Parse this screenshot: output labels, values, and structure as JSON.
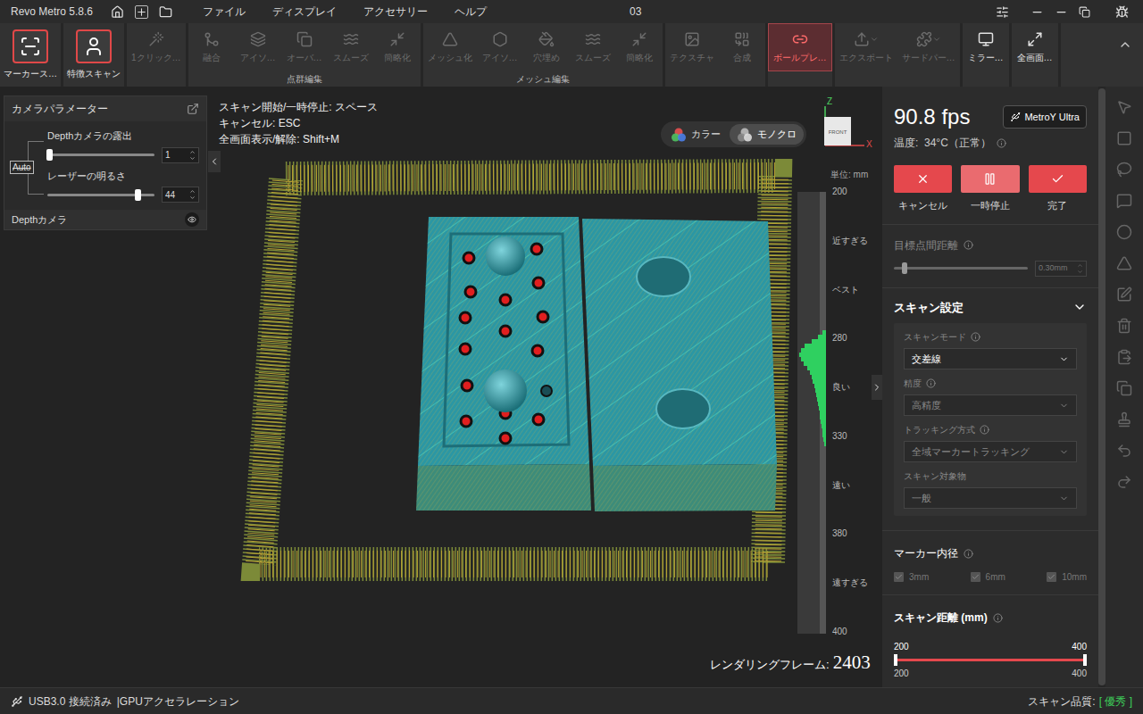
{
  "window": {
    "title": "Revo Metro 5.8.6",
    "document": "03"
  },
  "menu": [
    "ファイル",
    "ディスプレイ",
    "アクセサリー",
    "ヘルプ"
  ],
  "toolbar": {
    "groups": [
      {
        "label": "",
        "items": [
          {
            "label": "マーカース…",
            "kind": "scan",
            "disabled": false,
            "selected": false,
            "dropdown": false
          }
        ]
      },
      {
        "label": "",
        "items": [
          {
            "label": "特徴スキャン",
            "kind": "scan",
            "disabled": false,
            "selected": false,
            "dropdown": false
          }
        ]
      },
      {
        "label": "",
        "items": [
          {
            "label": "1クリック…",
            "kind": "tool",
            "disabled": true,
            "selected": false,
            "dropdown": false
          }
        ]
      },
      {
        "label": "点群編集",
        "items": [
          {
            "label": "融合",
            "kind": "tool",
            "disabled": true,
            "selected": false,
            "dropdown": false
          },
          {
            "label": "アイソ…",
            "kind": "tool",
            "disabled": true,
            "selected": false,
            "dropdown": false
          },
          {
            "label": "オーバ…",
            "kind": "tool",
            "disabled": true,
            "selected": false,
            "dropdown": false
          },
          {
            "label": "スムーズ",
            "kind": "tool",
            "disabled": true,
            "selected": false,
            "dropdown": false
          },
          {
            "label": "簡略化",
            "kind": "tool",
            "disabled": true,
            "selected": false,
            "dropdown": false
          }
        ]
      },
      {
        "label": "メッシュ編集",
        "items": [
          {
            "label": "メッシュ化",
            "kind": "tool",
            "disabled": true,
            "selected": false,
            "dropdown": false
          },
          {
            "label": "アイソ…",
            "kind": "tool",
            "disabled": true,
            "selected": false,
            "dropdown": false
          },
          {
            "label": "穴埋め",
            "kind": "tool",
            "disabled": true,
            "selected": false,
            "dropdown": false
          },
          {
            "label": "スムーズ",
            "kind": "tool",
            "disabled": true,
            "selected": false,
            "dropdown": false
          },
          {
            "label": "簡略化",
            "kind": "tool",
            "disabled": true,
            "selected": false,
            "dropdown": false
          }
        ]
      },
      {
        "label": "",
        "items": [
          {
            "label": "テクスチャ",
            "kind": "tool",
            "disabled": true,
            "selected": false,
            "dropdown": false
          },
          {
            "label": "合成",
            "kind": "tool",
            "disabled": true,
            "selected": false,
            "dropdown": false
          }
        ]
      },
      {
        "label": "",
        "items": [
          {
            "label": "ボールプレ…",
            "kind": "tool",
            "disabled": false,
            "selected": true,
            "dropdown": false
          }
        ]
      },
      {
        "label": "",
        "items": [
          {
            "label": "エクスポート",
            "kind": "tool",
            "disabled": true,
            "selected": false,
            "dropdown": true
          },
          {
            "label": "サードパー…",
            "kind": "tool",
            "disabled": true,
            "selected": false,
            "dropdown": true
          }
        ]
      },
      {
        "label": "",
        "items": [
          {
            "label": "ミラー…",
            "kind": "tool",
            "disabled": false,
            "selected": false,
            "dropdown": false
          }
        ]
      },
      {
        "label": "",
        "items": [
          {
            "label": "全画面…",
            "kind": "tool",
            "disabled": false,
            "selected": false,
            "dropdown": false
          }
        ]
      }
    ]
  },
  "camera_panel": {
    "title": "カメラパラメーター",
    "auto": {
      "label": "Auto",
      "on": false
    },
    "sliders": [
      {
        "label": "Depthカメラの露出",
        "level": 0.02,
        "value": "1"
      },
      {
        "label": "レーザーの明るさ",
        "level": 0.84,
        "value": "44"
      }
    ],
    "footer": {
      "label": "Depthカメラ",
      "visible": true
    }
  },
  "hints": [
    "スキャン開始/一時停止: スペース",
    "キャンセル: ESC",
    "全画面表示/解除: Shift+M"
  ],
  "view_modes": [
    {
      "label": "カラー",
      "selected": false
    },
    {
      "label": "モノクロ",
      "selected": true
    }
  ],
  "gizmo": {
    "face": "FRONT",
    "axes": [
      "Z",
      "X"
    ]
  },
  "distance_scale": {
    "unit": "単位: mm",
    "ticks": [
      "200",
      "近すぎる",
      "ベスト",
      "280",
      "良い",
      "330",
      "遠い",
      "380",
      "遠すぎる",
      "400"
    ],
    "histogram": [
      0.15,
      0.3,
      0.55,
      0.8,
      0.95,
      1,
      0.95,
      0.85,
      0.7,
      0.6,
      0.55,
      0.5,
      0.45,
      0.4,
      0.38,
      0.35,
      0.3,
      0.28,
      0.25,
      0.22,
      0.2,
      0.18,
      0.15,
      0.12,
      0.1,
      0.08
    ]
  },
  "render_frames": {
    "label": "レンダリングフレーム:",
    "value": "2403"
  },
  "scan_panel": {
    "fps": "90.8 fps",
    "device": "MetroY Ultra",
    "temperature": "温度:  34°C（正常）",
    "actions": [
      {
        "label": "キャンセル",
        "hovered": false
      },
      {
        "label": "一時停止",
        "hovered": true
      },
      {
        "label": "完了",
        "hovered": false
      }
    ],
    "point_distance": {
      "label": "目標点間距離",
      "level": 0.08,
      "value": "0.30mm",
      "disabled": true
    },
    "settings": {
      "title": "スキャン設定",
      "expanded": true,
      "fields": [
        {
          "label": "スキャンモード",
          "value": "交差線",
          "info": true,
          "disabled": false
        },
        {
          "label": "精度",
          "value": "高精度",
          "info": true,
          "disabled": true
        },
        {
          "label": "トラッキング方式",
          "value": "全域マーカートラッキング",
          "info": true,
          "disabled": true
        },
        {
          "label": "スキャン対象物",
          "value": "一般",
          "info": false,
          "disabled": true
        }
      ]
    },
    "marker_sizes": {
      "label": "マーカー内径",
      "options": [
        {
          "label": "3mm",
          "checked": true,
          "disabled": true
        },
        {
          "label": "6mm",
          "checked": true,
          "disabled": true
        },
        {
          "label": "10mm",
          "checked": true,
          "disabled": true
        }
      ]
    },
    "distance": {
      "label": "スキャン距離 (mm)",
      "min": "200",
      "max": "400",
      "low_label": "200",
      "high_label": "400",
      "low": 0,
      "high": 1
    }
  },
  "status_bar": {
    "connection": "USB3.0 接続済み",
    "acceleration": "|GPUアクセラレーション",
    "quality_label": "スキャン品質:",
    "quality": "[ 優秀 ]"
  }
}
